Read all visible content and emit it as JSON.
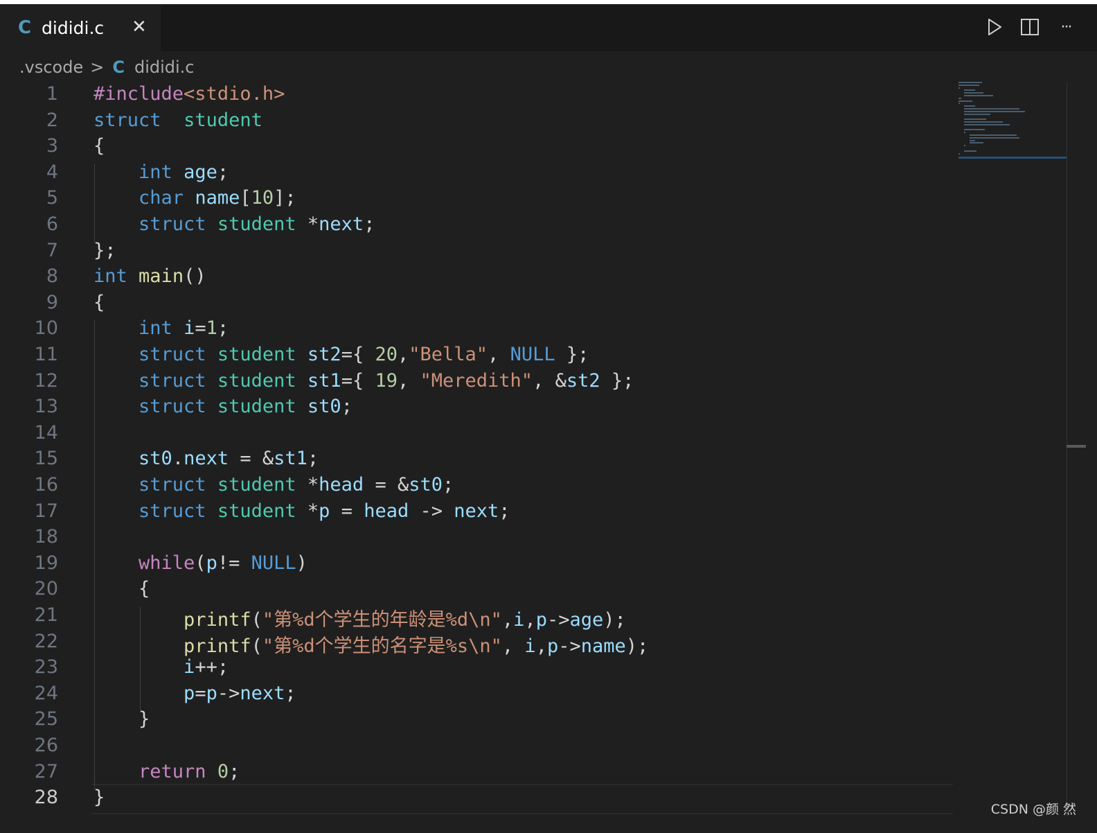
{
  "tab": {
    "icon": "c-language-icon",
    "icon_text": "C",
    "filename": "dididi.c",
    "close_glyph": "✕"
  },
  "actions": [
    {
      "name": "run-button",
      "icon": "play-icon"
    },
    {
      "name": "split-editor-button",
      "icon": "split-editor-icon"
    },
    {
      "name": "more-actions-button",
      "icon": "ellipsis-icon",
      "glyph": "···"
    }
  ],
  "breadcrumb": {
    "folder": ".vscode",
    "separator": ">",
    "icon_text": "C",
    "file": "dididi.c"
  },
  "editor": {
    "active_line": 28,
    "lines": [
      {
        "n": "1"
      },
      {
        "n": "2"
      },
      {
        "n": "3"
      },
      {
        "n": "4"
      },
      {
        "n": "5"
      },
      {
        "n": "6"
      },
      {
        "n": "7"
      },
      {
        "n": "8"
      },
      {
        "n": "9"
      },
      {
        "n": "10"
      },
      {
        "n": "11"
      },
      {
        "n": "12"
      },
      {
        "n": "13"
      },
      {
        "n": "14"
      },
      {
        "n": "15"
      },
      {
        "n": "16"
      },
      {
        "n": "17"
      },
      {
        "n": "18"
      },
      {
        "n": "19"
      },
      {
        "n": "20"
      },
      {
        "n": "21"
      },
      {
        "n": "22"
      },
      {
        "n": "23"
      },
      {
        "n": "24"
      },
      {
        "n": "25"
      },
      {
        "n": "26"
      },
      {
        "n": "27"
      },
      {
        "n": "28"
      }
    ],
    "code": [
      [
        [
          "pp",
          "#include"
        ],
        [
          "inc",
          "<stdio.h>"
        ]
      ],
      [
        [
          "kw",
          "struct"
        ],
        [
          "",
          "  "
        ],
        [
          "ty",
          "student"
        ]
      ],
      [
        [
          "",
          "{"
        ]
      ],
      [
        [
          "",
          "    "
        ],
        [
          "kw",
          "int"
        ],
        [
          "",
          " "
        ],
        [
          "var",
          "age"
        ],
        [
          "",
          ";"
        ]
      ],
      [
        [
          "",
          "    "
        ],
        [
          "kw",
          "char"
        ],
        [
          "",
          " "
        ],
        [
          "var",
          "name"
        ],
        [
          "",
          "["
        ],
        [
          "num",
          "10"
        ],
        [
          "",
          "];"
        ]
      ],
      [
        [
          "",
          "    "
        ],
        [
          "kw",
          "struct"
        ],
        [
          "",
          " "
        ],
        [
          "ty",
          "student"
        ],
        [
          "",
          " *"
        ],
        [
          "var",
          "next"
        ],
        [
          "",
          ";"
        ]
      ],
      [
        [
          "",
          "};"
        ]
      ],
      [
        [
          "kw",
          "int"
        ],
        [
          "",
          " "
        ],
        [
          "fn",
          "main"
        ],
        [
          "",
          "()"
        ]
      ],
      [
        [
          "",
          "{"
        ]
      ],
      [
        [
          "",
          "    "
        ],
        [
          "kw",
          "int"
        ],
        [
          "",
          " "
        ],
        [
          "var",
          "i"
        ],
        [
          "",
          "="
        ],
        [
          "num",
          "1"
        ],
        [
          "",
          ";"
        ]
      ],
      [
        [
          "",
          "    "
        ],
        [
          "kw",
          "struct"
        ],
        [
          "",
          " "
        ],
        [
          "ty",
          "student"
        ],
        [
          "",
          " "
        ],
        [
          "var",
          "st2"
        ],
        [
          "",
          "={ "
        ],
        [
          "num",
          "20"
        ],
        [
          "",
          ","
        ],
        [
          "str",
          "\"Bella\""
        ],
        [
          "",
          ", "
        ],
        [
          "kw",
          "NULL"
        ],
        [
          "",
          " };"
        ]
      ],
      [
        [
          "",
          "    "
        ],
        [
          "kw",
          "struct"
        ],
        [
          "",
          " "
        ],
        [
          "ty",
          "student"
        ],
        [
          "",
          " "
        ],
        [
          "var",
          "st1"
        ],
        [
          "",
          "={ "
        ],
        [
          "num",
          "19"
        ],
        [
          "",
          ", "
        ],
        [
          "str",
          "\"Meredith\""
        ],
        [
          "",
          ", &"
        ],
        [
          "var",
          "st2"
        ],
        [
          "",
          " };"
        ]
      ],
      [
        [
          "",
          "    "
        ],
        [
          "kw",
          "struct"
        ],
        [
          "",
          " "
        ],
        [
          "ty",
          "student"
        ],
        [
          "",
          " "
        ],
        [
          "var",
          "st0"
        ],
        [
          "",
          ";"
        ]
      ],
      [],
      [
        [
          "",
          "    "
        ],
        [
          "var",
          "st0"
        ],
        [
          "",
          "."
        ],
        [
          "var",
          "next"
        ],
        [
          "",
          " = &"
        ],
        [
          "var",
          "st1"
        ],
        [
          "",
          ";"
        ]
      ],
      [
        [
          "",
          "    "
        ],
        [
          "kw",
          "struct"
        ],
        [
          "",
          " "
        ],
        [
          "ty",
          "student"
        ],
        [
          "",
          " *"
        ],
        [
          "var",
          "head"
        ],
        [
          "",
          " = &"
        ],
        [
          "var",
          "st0"
        ],
        [
          "",
          ";"
        ]
      ],
      [
        [
          "",
          "    "
        ],
        [
          "kw",
          "struct"
        ],
        [
          "",
          " "
        ],
        [
          "ty",
          "student"
        ],
        [
          "",
          " *"
        ],
        [
          "var",
          "p"
        ],
        [
          "",
          " = "
        ],
        [
          "var",
          "head"
        ],
        [
          "",
          " -> "
        ],
        [
          "var",
          "next"
        ],
        [
          "",
          ";"
        ]
      ],
      [],
      [
        [
          "",
          "    "
        ],
        [
          "ctl",
          "while"
        ],
        [
          "",
          "("
        ],
        [
          "var",
          "p"
        ],
        [
          "",
          "!= "
        ],
        [
          "kw",
          "NULL"
        ],
        [
          "",
          ")"
        ]
      ],
      [
        [
          "",
          "    {"
        ]
      ],
      [
        [
          "",
          "        "
        ],
        [
          "fn",
          "printf"
        ],
        [
          "",
          "("
        ],
        [
          "str",
          "\"第%d个学生的年龄是%d\\n\""
        ],
        [
          "",
          ","
        ],
        [
          "var",
          "i"
        ],
        [
          "",
          ","
        ],
        [
          "var",
          "p"
        ],
        [
          "",
          "->"
        ],
        [
          "var",
          "age"
        ],
        [
          "",
          ");"
        ]
      ],
      [
        [
          "",
          "        "
        ],
        [
          "fn",
          "printf"
        ],
        [
          "",
          "("
        ],
        [
          "str",
          "\"第%d个学生的名字是%s\\n\""
        ],
        [
          "",
          ", "
        ],
        [
          "var",
          "i"
        ],
        [
          "",
          ","
        ],
        [
          "var",
          "p"
        ],
        [
          "",
          "->"
        ],
        [
          "var",
          "name"
        ],
        [
          "",
          ");"
        ]
      ],
      [
        [
          "",
          "        "
        ],
        [
          "var",
          "i"
        ],
        [
          "",
          "++;"
        ]
      ],
      [
        [
          "",
          "        "
        ],
        [
          "var",
          "p"
        ],
        [
          "",
          "="
        ],
        [
          "var",
          "p"
        ],
        [
          "",
          "->"
        ],
        [
          "var",
          "next"
        ],
        [
          "",
          ";"
        ]
      ],
      [
        [
          "",
          "    }"
        ]
      ],
      [],
      [
        [
          "",
          "    "
        ],
        [
          "ctl",
          "return"
        ],
        [
          "",
          " "
        ],
        [
          "num",
          "0"
        ],
        [
          "",
          ";"
        ]
      ],
      [
        [
          "",
          "}"
        ]
      ]
    ]
  },
  "watermark": "CSDN @颜 然",
  "colors": {
    "background": "#1f1f1f",
    "tabbar": "#181818",
    "keyword": "#569cd6",
    "type": "#4ec9b0",
    "function": "#dcdcaa",
    "variable": "#9cdcfe",
    "string": "#ce9178",
    "number": "#b5cea8",
    "control": "#c586c0",
    "c_icon": "#519aba"
  }
}
